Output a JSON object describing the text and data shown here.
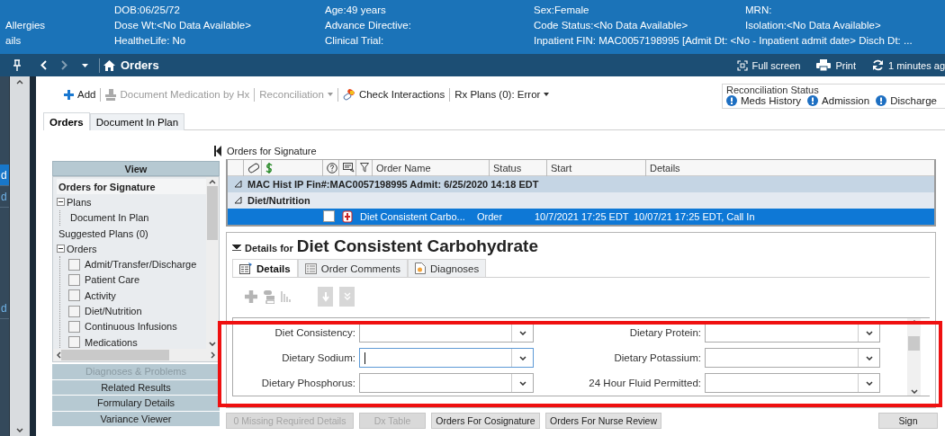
{
  "banner": {
    "left_labels": [
      "Allergies",
      "ails"
    ],
    "columns": [
      [
        "DOB:06/25/72",
        "Dose Wt:<No Data Available>",
        "HealtheLife: No"
      ],
      [
        "Age:49 years",
        "Advance Directive:",
        "Clinical Trial:"
      ],
      [
        "Sex:Female",
        "Code Status:<No Data Available>",
        "Inpatient FIN: MAC0057198995 [Admit Dt: <No - Inpatient admit date> Disch Dt: ..."
      ],
      [
        "MRN:",
        "Isolation:<No Data Available>"
      ]
    ]
  },
  "nav": {
    "title": "Orders",
    "actions": [
      {
        "kind": "fullscreen",
        "label": "Full screen"
      },
      {
        "kind": "print",
        "label": "Print"
      },
      {
        "kind": "refresh",
        "label": "1 minutes ag"
      }
    ]
  },
  "side_strip": {
    "items": [
      {
        "label": "d",
        "selected": true
      },
      {
        "label": "d",
        "selected": false
      },
      {
        "label": "d",
        "selected": false
      }
    ]
  },
  "toolbar": [
    {
      "kind": "add",
      "label": "Add",
      "disabled": false
    },
    {
      "kind": "document",
      "label": "Document Medication by Hx",
      "disabled": true
    },
    {
      "kind": "menu",
      "label": "Reconciliation",
      "disabled": true
    },
    {
      "kind": "interactions",
      "label": "Check Interactions",
      "disabled": false
    },
    {
      "kind": "menu",
      "label": "Rx Plans (0): Error",
      "disabled": false
    }
  ],
  "reconciliation_status": {
    "title": "Reconciliation Status",
    "items": [
      "Meds History",
      "Admission",
      "Discharge"
    ]
  },
  "tabs": [
    {
      "label": "Orders",
      "selected": true
    },
    {
      "label": "Document In Plan",
      "selected": false
    }
  ],
  "sidebar": {
    "header": "View",
    "tree": [
      {
        "kind": "item",
        "label": "Orders for Signature",
        "selected": true
      },
      {
        "kind": "folder",
        "label": "Plans",
        "expanded": true,
        "selected": false,
        "children": [
          {
            "kind": "item",
            "label": "Document In Plan",
            "selected": false
          }
        ]
      },
      {
        "kind": "item",
        "label": "Suggested Plans (0)",
        "selected": false
      },
      {
        "kind": "folder",
        "label": "Orders",
        "expanded": true,
        "selected": false,
        "children": [
          {
            "kind": "checkbox",
            "label": "Admit/Transfer/Discharge",
            "checked": false,
            "selected": false
          },
          {
            "kind": "checkbox",
            "label": "Patient Care",
            "checked": false,
            "selected": false
          },
          {
            "kind": "checkbox",
            "label": "Activity",
            "checked": false,
            "selected": false
          },
          {
            "kind": "checkbox",
            "label": "Diet/Nutrition",
            "checked": false,
            "selected": false
          },
          {
            "kind": "checkbox",
            "label": "Continuous Infusions",
            "checked": false,
            "selected": false
          },
          {
            "kind": "checkbox",
            "label": "Medications",
            "checked": false,
            "selected": false
          }
        ]
      }
    ],
    "buttons": [
      {
        "label": "Diagnoses & Problems",
        "disabled": true
      },
      {
        "label": "Related Results",
        "disabled": false
      },
      {
        "label": "Formulary Details",
        "disabled": false
      },
      {
        "label": "Variance Viewer",
        "disabled": false
      }
    ]
  },
  "orders": {
    "title": "Orders for Signature",
    "columns": [
      "Order Name",
      "Status",
      "Start",
      "Details"
    ],
    "groups": [
      {
        "title": "MAC Hist IP  Fin#:MAC0057198995  Admit: 6/25/2020 14:18 EDT",
        "expanded": true,
        "children": [
          {
            "title": "Diet/Nutrition",
            "expanded": true,
            "rows": [
              {
                "checked": false,
                "selected": true,
                "cells": [
                  "Diet Consistent Carbo...",
                  "Order",
                  "10/7/2021 17:25 EDT",
                  "10/07/21 17:25 EDT, Call In"
                ]
              }
            ]
          }
        ]
      }
    ]
  },
  "details": {
    "prefix": "Details for",
    "title": "Diet Consistent Carbohydrate",
    "tabs": [
      {
        "kind": "details",
        "label": "Details",
        "selected": true
      },
      {
        "kind": "comments",
        "label": "Order Comments",
        "selected": false
      },
      {
        "kind": "diagnoses",
        "label": "Diagnoses",
        "selected": false
      }
    ],
    "fields": [
      {
        "kind": "dropdown",
        "label": "Diet Consistency:",
        "focused": false
      },
      {
        "kind": "dropdown",
        "label": "Dietary Protein:",
        "focused": false
      },
      {
        "kind": "dropdown",
        "label": "Dietary Sodium:",
        "focused": true
      },
      {
        "kind": "dropdown",
        "label": "Dietary Potassium:",
        "focused": false
      },
      {
        "kind": "dropdown",
        "label": "Dietary Phosphorus:",
        "focused": false
      },
      {
        "kind": "dropdown",
        "label": "24 Hour Fluid Permitted:",
        "focused": false
      }
    ]
  },
  "footer": {
    "buttons": [
      {
        "label": "0 Missing Required Details",
        "disabled": true
      },
      {
        "label": "Dx Table",
        "disabled": true
      },
      {
        "label": "Orders For Cosignature",
        "disabled": false
      },
      {
        "label": "Orders For Nurse Review",
        "disabled": false
      }
    ],
    "sign": {
      "label": "Sign",
      "disabled": false
    }
  },
  "annotation": {
    "kind": "highlight"
  }
}
